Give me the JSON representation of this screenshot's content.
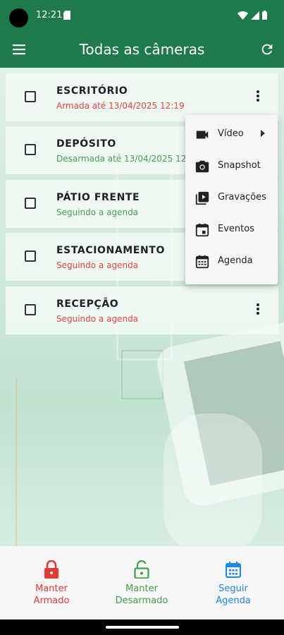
{
  "status_bar": {
    "time": "12:21"
  },
  "app_bar": {
    "title": "Todas as câmeras"
  },
  "cameras": [
    {
      "name": "ESCRITÓRIO",
      "status": "Armada até 13/04/2025 12:19"
    },
    {
      "name": "DEPÓSITO",
      "status": "Desarmada até 13/04/2025 12:19"
    },
    {
      "name": "PÁTIO FRENTE",
      "status": "Seguindo a agenda"
    },
    {
      "name": "ESTACIONAMENTO",
      "status": "Seguindo a agenda"
    },
    {
      "name": "RECEPÇÃO",
      "status": "Seguindo a agenda"
    }
  ],
  "context_menu": {
    "items": [
      {
        "label": "Vídeo",
        "icon": "videocam-icon"
      },
      {
        "label": "Snapshot",
        "icon": "camera-icon"
      },
      {
        "label": "Gravações",
        "icon": "video-library-icon"
      },
      {
        "label": "Eventos",
        "icon": "event-icon"
      },
      {
        "label": "Agenda",
        "icon": "calendar-icon"
      }
    ]
  },
  "bottom_actions": [
    {
      "label": "Manter\nArmado",
      "icon": "lock-icon",
      "color": "#e53935"
    },
    {
      "label": "Manter\nDesarmado",
      "icon": "unlock-icon",
      "color": "#43a047"
    },
    {
      "label": "Seguir\nAgenda",
      "icon": "calendar-icon",
      "color": "#1e88e5"
    }
  ],
  "colors": {
    "primary": "#1e7a4a",
    "armed": "#e8443d",
    "disarmed": "#43a34d",
    "schedule": "#1e88e5"
  }
}
